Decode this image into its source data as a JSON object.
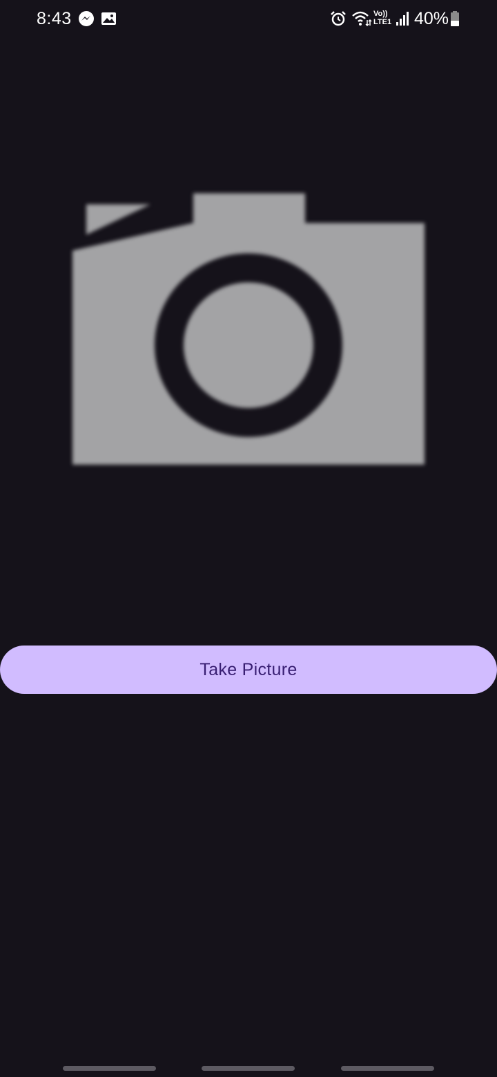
{
  "status_bar": {
    "time": "8:43",
    "volte_line1": "Vo))",
    "volte_line2": "LTE1",
    "battery_percent": "40%",
    "battery_level": 0.4,
    "icons": [
      "messenger-icon",
      "gallery-icon",
      "alarm-icon",
      "wifi-icon",
      "volte-icon",
      "signal-icon",
      "battery-icon"
    ]
  },
  "main": {
    "image_icon": "camera-placeholder-icon",
    "take_picture_label": "Take Picture"
  },
  "colors": {
    "background": "#15121a",
    "button_bg": "#d1bcff",
    "button_text": "#381e72",
    "camera_gray": "#a3a3a5"
  },
  "nav_bar": {
    "handles": [
      "recent-apps-handle",
      "home-handle",
      "back-handle"
    ]
  }
}
